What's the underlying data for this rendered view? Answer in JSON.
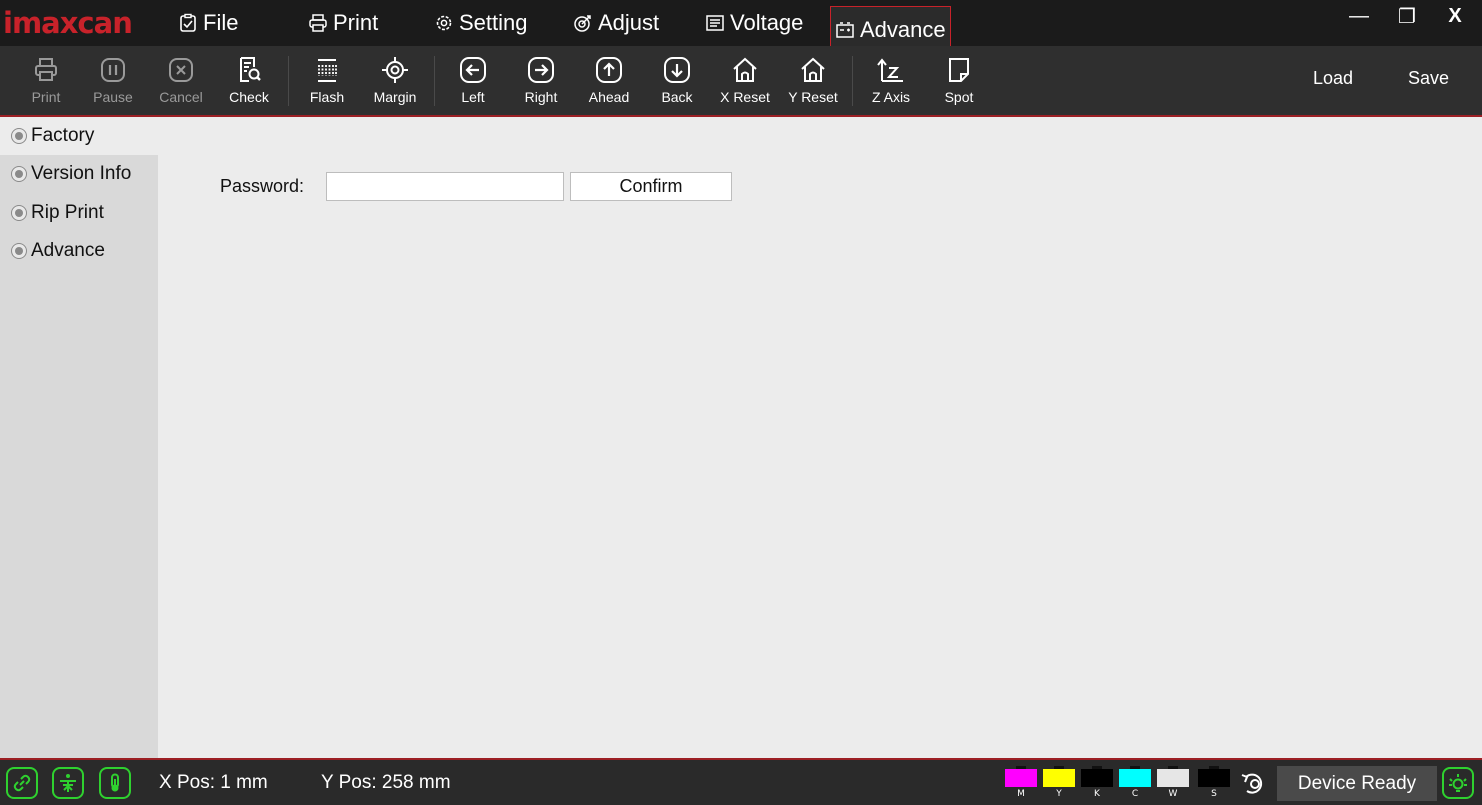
{
  "app": {
    "logo": "imaxcan"
  },
  "menu": [
    {
      "label": "File",
      "icon": "clipboard-check-icon"
    },
    {
      "label": "Print",
      "icon": "printer-icon"
    },
    {
      "label": "Setting",
      "icon": "gear-icon"
    },
    {
      "label": "Adjust",
      "icon": "target-icon"
    },
    {
      "label": "Voltage",
      "icon": "list-doc-icon"
    },
    {
      "label": "Advance",
      "icon": "battery-icon",
      "active": true
    }
  ],
  "window_controls": {
    "minimize": "—",
    "restore": "❐",
    "close": "X"
  },
  "toolbar": {
    "tools": [
      {
        "label": "Print",
        "icon": "printer-icon",
        "enabled": false
      },
      {
        "label": "Pause",
        "icon": "pause-icon",
        "enabled": false
      },
      {
        "label": "Cancel",
        "icon": "cancel-icon",
        "enabled": false
      },
      {
        "label": "Check",
        "icon": "check-doc-icon",
        "enabled": true
      },
      {
        "label": "Flash",
        "icon": "flash-grid-icon",
        "enabled": true
      },
      {
        "label": "Margin",
        "icon": "crosshair-icon",
        "enabled": true
      },
      {
        "label": "Left",
        "icon": "arrow-left-icon",
        "enabled": true
      },
      {
        "label": "Right",
        "icon": "arrow-right-icon",
        "enabled": true
      },
      {
        "label": "Ahead",
        "icon": "arrow-up-icon",
        "enabled": true
      },
      {
        "label": "Back",
        "icon": "arrow-down-icon",
        "enabled": true
      },
      {
        "label": "X Reset",
        "icon": "home-icon",
        "enabled": true
      },
      {
        "label": "Y Reset",
        "icon": "home-icon",
        "enabled": true
      },
      {
        "label": "Z Axis",
        "icon": "z-axis-icon",
        "enabled": true
      },
      {
        "label": "Spot",
        "icon": "spot-icon",
        "enabled": true
      }
    ],
    "load_label": "Load",
    "save_label": "Save"
  },
  "sidebar": {
    "items": [
      {
        "label": "Factory",
        "active": false
      },
      {
        "label": "Version Info",
        "active": true
      },
      {
        "label": "Rip Print",
        "active": true
      },
      {
        "label": "Advance",
        "active": true
      }
    ]
  },
  "main": {
    "password_label": "Password:",
    "password_value": "",
    "confirm_label": "Confirm"
  },
  "status": {
    "x_pos": "X Pos: 1 mm",
    "y_pos": "Y Pos: 258 mm",
    "inks": [
      {
        "label": "M",
        "color": "#ff00ff"
      },
      {
        "label": "Y",
        "color": "#ffff00"
      },
      {
        "label": "K",
        "color": "#000000"
      },
      {
        "label": "C",
        "color": "#00ffff"
      },
      {
        "label": "W",
        "color": "#e6e6e6"
      },
      {
        "label": "S",
        "color": "#000000"
      }
    ],
    "device_state": "Device Ready",
    "colors": {
      "indicator": "#2fd12f",
      "accent": "#c8222a"
    }
  }
}
